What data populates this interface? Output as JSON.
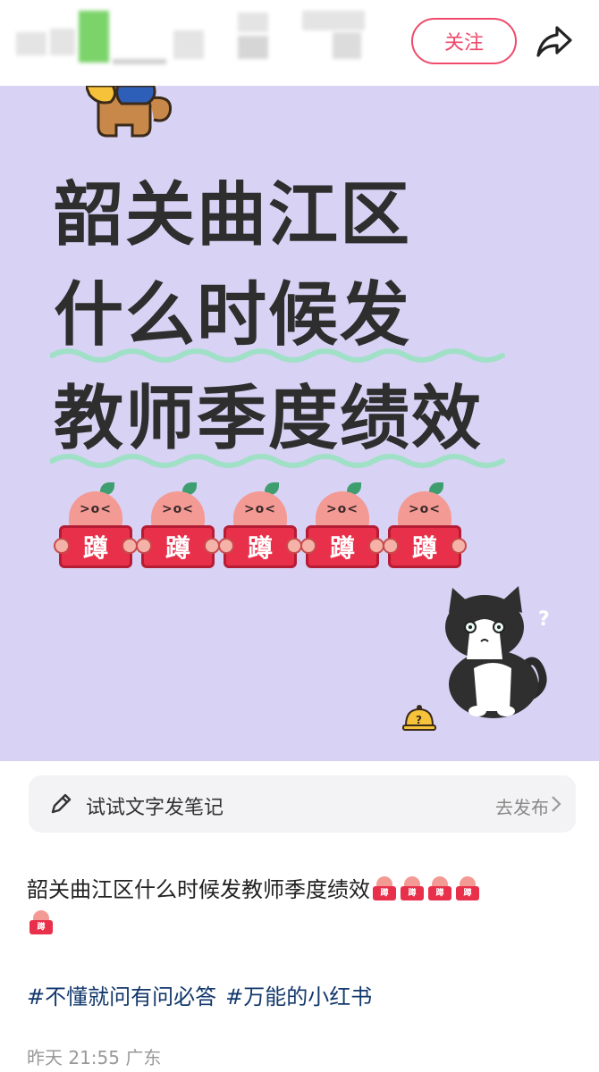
{
  "header": {
    "follow_label": "关注",
    "icons": {
      "share": "share-arrow-icon"
    }
  },
  "card": {
    "title_lines": [
      "韶关曲江区",
      "什么时候发",
      "教师季度绩效"
    ],
    "sign_char": "蹲",
    "chick_face": ">o<",
    "cat_question": "?",
    "bg_color": "#d8d2f4",
    "wave_color": "#9fe0c6"
  },
  "composer": {
    "placeholder": "试试文字发笔记",
    "action_label": "去发布",
    "icons": {
      "pencil": "pencil-icon",
      "chevron": "chevron-right-icon"
    }
  },
  "post": {
    "text": "韶关曲江区什么时候发教师季度绩效",
    "tags": [
      "#不懂就问有问必答",
      "#万能的小红书"
    ],
    "time": "昨天 21:55",
    "location": "广东",
    "tag_color": "#13386c"
  },
  "colors": {
    "accent": "#ef4a6b",
    "sign_red": "#e8304a"
  }
}
